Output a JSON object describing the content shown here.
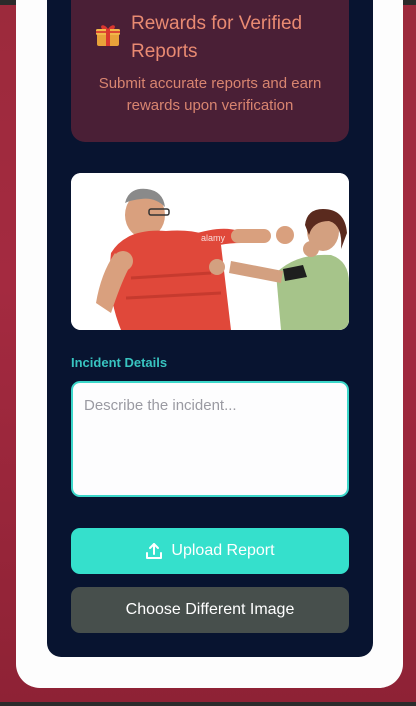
{
  "rewards": {
    "icon": "gift-icon",
    "title": "Rewards for Verified Reports",
    "subtitle": "Submit accurate reports and earn rewards upon verification"
  },
  "photo": {
    "watermark_text": "alamy",
    "description_hidden": true
  },
  "incident": {
    "label": "Incident Details",
    "placeholder": "Describe the incident...",
    "value": ""
  },
  "actions": {
    "upload_label": "Upload Report",
    "upload_icon": "upload-icon",
    "choose_label": "Choose Different Image"
  },
  "colors": {
    "background": "#9c2a3c",
    "panel": "#081430",
    "accent": "#35e0cc",
    "rewards_text": "#e98a72",
    "secondary_button": "#474f4c"
  }
}
